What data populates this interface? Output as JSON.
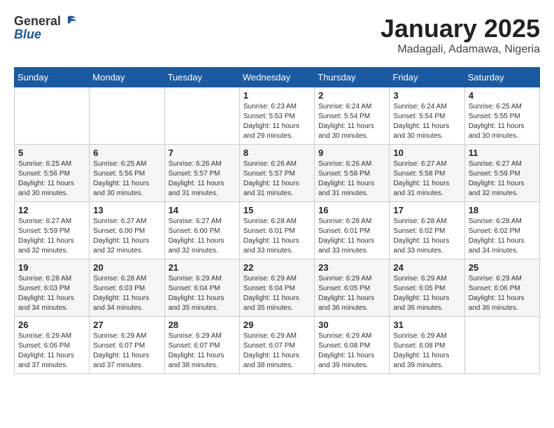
{
  "header": {
    "logo_general": "General",
    "logo_blue": "Blue",
    "month_title": "January 2025",
    "location": "Madagali, Adamawa, Nigeria"
  },
  "weekdays": [
    "Sunday",
    "Monday",
    "Tuesday",
    "Wednesday",
    "Thursday",
    "Friday",
    "Saturday"
  ],
  "weeks": [
    [
      {
        "day": null
      },
      {
        "day": null
      },
      {
        "day": null
      },
      {
        "day": "1",
        "sunrise": "6:23 AM",
        "sunset": "5:53 PM",
        "daylight": "11 hours and 29 minutes."
      },
      {
        "day": "2",
        "sunrise": "6:24 AM",
        "sunset": "5:54 PM",
        "daylight": "11 hours and 30 minutes."
      },
      {
        "day": "3",
        "sunrise": "6:24 AM",
        "sunset": "5:54 PM",
        "daylight": "11 hours and 30 minutes."
      },
      {
        "day": "4",
        "sunrise": "6:25 AM",
        "sunset": "5:55 PM",
        "daylight": "11 hours and 30 minutes."
      }
    ],
    [
      {
        "day": "5",
        "sunrise": "6:25 AM",
        "sunset": "5:56 PM",
        "daylight": "11 hours and 30 minutes."
      },
      {
        "day": "6",
        "sunrise": "6:25 AM",
        "sunset": "5:56 PM",
        "daylight": "11 hours and 30 minutes."
      },
      {
        "day": "7",
        "sunrise": "6:26 AM",
        "sunset": "5:57 PM",
        "daylight": "11 hours and 31 minutes."
      },
      {
        "day": "8",
        "sunrise": "6:26 AM",
        "sunset": "5:57 PM",
        "daylight": "11 hours and 31 minutes."
      },
      {
        "day": "9",
        "sunrise": "6:26 AM",
        "sunset": "5:58 PM",
        "daylight": "11 hours and 31 minutes."
      },
      {
        "day": "10",
        "sunrise": "6:27 AM",
        "sunset": "5:58 PM",
        "daylight": "11 hours and 31 minutes."
      },
      {
        "day": "11",
        "sunrise": "6:27 AM",
        "sunset": "5:59 PM",
        "daylight": "11 hours and 32 minutes."
      }
    ],
    [
      {
        "day": "12",
        "sunrise": "6:27 AM",
        "sunset": "5:59 PM",
        "daylight": "11 hours and 32 minutes."
      },
      {
        "day": "13",
        "sunrise": "6:27 AM",
        "sunset": "6:00 PM",
        "daylight": "11 hours and 32 minutes."
      },
      {
        "day": "14",
        "sunrise": "6:27 AM",
        "sunset": "6:00 PM",
        "daylight": "11 hours and 32 minutes."
      },
      {
        "day": "15",
        "sunrise": "6:28 AM",
        "sunset": "6:01 PM",
        "daylight": "11 hours and 33 minutes."
      },
      {
        "day": "16",
        "sunrise": "6:28 AM",
        "sunset": "6:01 PM",
        "daylight": "11 hours and 33 minutes."
      },
      {
        "day": "17",
        "sunrise": "6:28 AM",
        "sunset": "6:02 PM",
        "daylight": "11 hours and 33 minutes."
      },
      {
        "day": "18",
        "sunrise": "6:28 AM",
        "sunset": "6:02 PM",
        "daylight": "11 hours and 34 minutes."
      }
    ],
    [
      {
        "day": "19",
        "sunrise": "6:28 AM",
        "sunset": "6:03 PM",
        "daylight": "11 hours and 34 minutes."
      },
      {
        "day": "20",
        "sunrise": "6:28 AM",
        "sunset": "6:03 PM",
        "daylight": "11 hours and 34 minutes."
      },
      {
        "day": "21",
        "sunrise": "6:29 AM",
        "sunset": "6:04 PM",
        "daylight": "11 hours and 35 minutes."
      },
      {
        "day": "22",
        "sunrise": "6:29 AM",
        "sunset": "6:04 PM",
        "daylight": "11 hours and 35 minutes."
      },
      {
        "day": "23",
        "sunrise": "6:29 AM",
        "sunset": "6:05 PM",
        "daylight": "11 hours and 36 minutes."
      },
      {
        "day": "24",
        "sunrise": "6:29 AM",
        "sunset": "6:05 PM",
        "daylight": "11 hours and 36 minutes."
      },
      {
        "day": "25",
        "sunrise": "6:29 AM",
        "sunset": "6:06 PM",
        "daylight": "11 hours and 36 minutes."
      }
    ],
    [
      {
        "day": "26",
        "sunrise": "6:29 AM",
        "sunset": "6:06 PM",
        "daylight": "11 hours and 37 minutes."
      },
      {
        "day": "27",
        "sunrise": "6:29 AM",
        "sunset": "6:07 PM",
        "daylight": "11 hours and 37 minutes."
      },
      {
        "day": "28",
        "sunrise": "6:29 AM",
        "sunset": "6:07 PM",
        "daylight": "11 hours and 38 minutes."
      },
      {
        "day": "29",
        "sunrise": "6:29 AM",
        "sunset": "6:07 PM",
        "daylight": "11 hours and 38 minutes."
      },
      {
        "day": "30",
        "sunrise": "6:29 AM",
        "sunset": "6:08 PM",
        "daylight": "11 hours and 39 minutes."
      },
      {
        "day": "31",
        "sunrise": "6:29 AM",
        "sunset": "6:08 PM",
        "daylight": "11 hours and 39 minutes."
      },
      {
        "day": null
      }
    ]
  ]
}
